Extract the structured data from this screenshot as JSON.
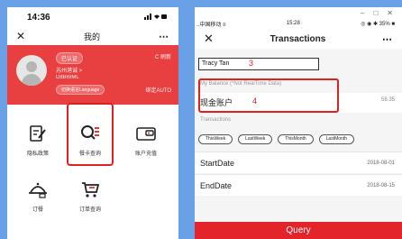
{
  "left": {
    "status": {
      "time": "14:36",
      "signal": "………"
    },
    "nav": {
      "close": "✕",
      "title": "我的",
      "more": "⋯"
    },
    "banner": {
      "badge": "已认证",
      "line1": "苏州港诚 >",
      "line2": "D8BWML",
      "lang": "切换语言Language",
      "refresh": "C 刷新",
      "bid": "绑定AUTO"
    },
    "grid": [
      {
        "label": "隐私政策",
        "icon": "document-pen-icon"
      },
      {
        "label": "餐卡查询",
        "icon": "search-list-icon"
      },
      {
        "label": "账户充值",
        "icon": "card-icon"
      },
      {
        "label": "订餐",
        "icon": "food-cover-icon"
      },
      {
        "label": "订单查询",
        "icon": "cart-icon"
      }
    ],
    "highlight_color": "#e02020",
    "banner_color": "#e84040"
  },
  "right": {
    "window": {
      "minimize": "–",
      "maximize": "□",
      "close": "✕"
    },
    "status": {
      "carrier": "..中国移动 ≡",
      "time": "15:28",
      "battery": "◎ ◉ ✱ 35% ■"
    },
    "nav": {
      "close": "✕",
      "title": "Transactions",
      "more": "⋯"
    },
    "name_input": {
      "value": "Tracy Tan"
    },
    "annotation_3": "3",
    "annotation_4": "4",
    "balance_label": "My Balance  (*Not RealTime Data)",
    "account_name": "现金账户",
    "account_value": "58.35",
    "transactions_label": "Transactions",
    "filters": [
      "ThisWeek",
      "LastWeek",
      "ThisMonth",
      "LastMonth"
    ],
    "start": {
      "label": "StartDate",
      "value": "2018-08-01"
    },
    "end": {
      "label": "EndDate",
      "value": "2018-08-15"
    },
    "query_label": "Query",
    "accent_color": "#e3242b"
  }
}
